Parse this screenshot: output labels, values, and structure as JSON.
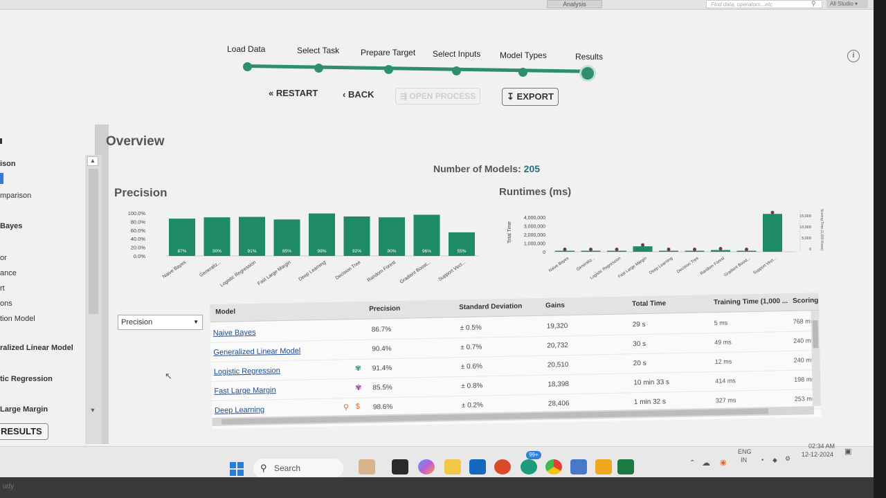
{
  "topbar": {
    "tab_label": "Analysis",
    "find_placeholder": "Find data, operators...etc",
    "studio_label": "All Studio ▾"
  },
  "stepper": {
    "steps": [
      "Load Data",
      "Select Task",
      "Prepare Target",
      "Select Inputs",
      "Model Types",
      "Results"
    ],
    "active_index": 5
  },
  "actions": {
    "restart": "RESTART",
    "back": "BACK",
    "open_process": "OPEN PROCESS",
    "export": "EXPORT"
  },
  "sidebar": {
    "items": [
      "ison",
      "mparison",
      "Bayes",
      "or",
      "ance",
      "rt",
      "ons",
      "tion Model",
      "ralized Linear Model",
      "tic Regression",
      "Large Margin"
    ],
    "results_button": "RESULTS"
  },
  "overview": {
    "title": "Overview",
    "models_label": "Number of Models:",
    "models_count": "205",
    "precision_title": "Precision",
    "runtimes_title": "Runtimes (ms)"
  },
  "chart_data": [
    {
      "type": "bar",
      "title": "Precision",
      "categories": [
        "Naive Bayes",
        "Generaliz...",
        "Logistic Regression",
        "Fast Large Margin",
        "Deep Learning",
        "Decision Tree",
        "Random Forest",
        "Gradient Boost...",
        "Support Vect..."
      ],
      "values": [
        87,
        90,
        91,
        85,
        99,
        92,
        90,
        96,
        55
      ],
      "value_labels": [
        "87%",
        "90%",
        "91%",
        "85%",
        "99%",
        "92%",
        "90%",
        "96%",
        "55%"
      ],
      "yticks": [
        "100.0%",
        "80.0%",
        "60.0%",
        "40.0%",
        "20.0%",
        "0.0%"
      ],
      "ylim": [
        0,
        100
      ],
      "color": "#1f8a66"
    },
    {
      "type": "bar",
      "title": "Runtimes (ms)",
      "ylabel": "Total Time",
      "categories": [
        "Naive Bayes",
        "Generaliz...",
        "Logistic Regression",
        "Fast Large Margin",
        "Deep Learning",
        "Decision Tree",
        "Random Forest",
        "Gradient Boost...",
        "Support Vect..."
      ],
      "values": [
        29000,
        30000,
        20000,
        633000,
        92000,
        60000,
        200000,
        120000,
        4400000
      ],
      "yticks": [
        "4,000,000",
        "3,000,000",
        "2,000,000",
        "1,000,000",
        "0"
      ],
      "ylim": [
        0,
        4500000
      ],
      "right_ticks": [
        "15,000",
        "10,000",
        "5,000",
        "0"
      ],
      "right_label": "Scoring Time (1,000 Rows)",
      "color": "#1f8a66",
      "marker_color": "#6a3a5a"
    }
  ],
  "table": {
    "metric_select": "Precision",
    "columns": [
      "Model",
      "Precision",
      "Standard Deviation",
      "Gains",
      "Total Time",
      "Training Time (1,000 ...",
      "Scoring"
    ],
    "rows": [
      {
        "model": "Naive Bayes",
        "precision": "86.7%",
        "sd": "± 0.5%",
        "gains": "19,320",
        "total": "29 s",
        "train": "5 ms",
        "score": "768 ms"
      },
      {
        "model": "Generalized Linear Model",
        "precision": "90.4%",
        "sd": "± 0.7%",
        "gains": "20,732",
        "total": "30 s",
        "train": "49 ms",
        "score": "240 ms"
      },
      {
        "model": "Logistic Regression",
        "precision": "91.4%",
        "sd": "± 0.6%",
        "gains": "20,510",
        "total": "20 s",
        "train": "12 ms",
        "score": "240 ms"
      },
      {
        "model": "Fast Large Margin",
        "precision": "85.5%",
        "sd": "± 0.8%",
        "gains": "18,398",
        "total": "10 min 33 s",
        "train": "414 ms",
        "score": "198 ms"
      },
      {
        "model": "Deep Learning",
        "precision": "98.6%",
        "sd": "± 0.2%",
        "gains": "28,406",
        "total": "1 min 32 s",
        "train": "327 ms",
        "score": "253 ms"
      }
    ]
  },
  "taskbar": {
    "search_label": "Search",
    "badge": "99+",
    "lang_top": "ENG",
    "lang_bottom": "IN",
    "time": "02:34 AM",
    "date": "12-12-2024"
  },
  "bezel_text": "udy"
}
